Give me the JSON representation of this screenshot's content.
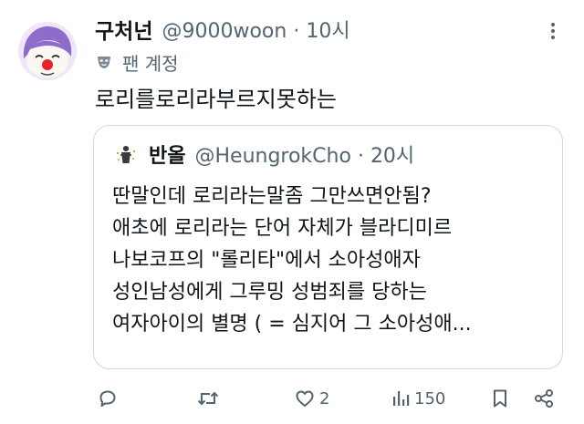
{
  "tweet": {
    "author_name": "구처넌",
    "author_handle": "@9000woon",
    "time": "10시",
    "badge_label": "팬 계정",
    "text": "로리를로리라부르지못하는"
  },
  "quoted_tweet": {
    "author_name": "반올",
    "author_handle": "@HeungrokCho",
    "time": "20시",
    "lines": [
      "딴말인데 로리라는말좀 그만쓰면안됨?",
      "애초에 로리라는 단어 자체가 블라디미르",
      "나보코프의 \"롤리타\"에서 소아성애자",
      "성인남성에게 그루밍 성범죄를 당하는",
      "여자아이의 별명 ( = 심지어 그 소아성애..."
    ]
  },
  "actions": {
    "reply_count": "",
    "retweet_count": "",
    "like_count": "2",
    "view_count": "150"
  },
  "colors": {
    "text": "#0f1419",
    "secondary": "#536471",
    "border": "#cfd9de",
    "background": "#ffffff"
  },
  "icons": [
    "more-icon",
    "mask-icon",
    "reply-icon",
    "retweet-icon",
    "like-icon",
    "views-icon",
    "bookmark-icon",
    "share-icon"
  ]
}
